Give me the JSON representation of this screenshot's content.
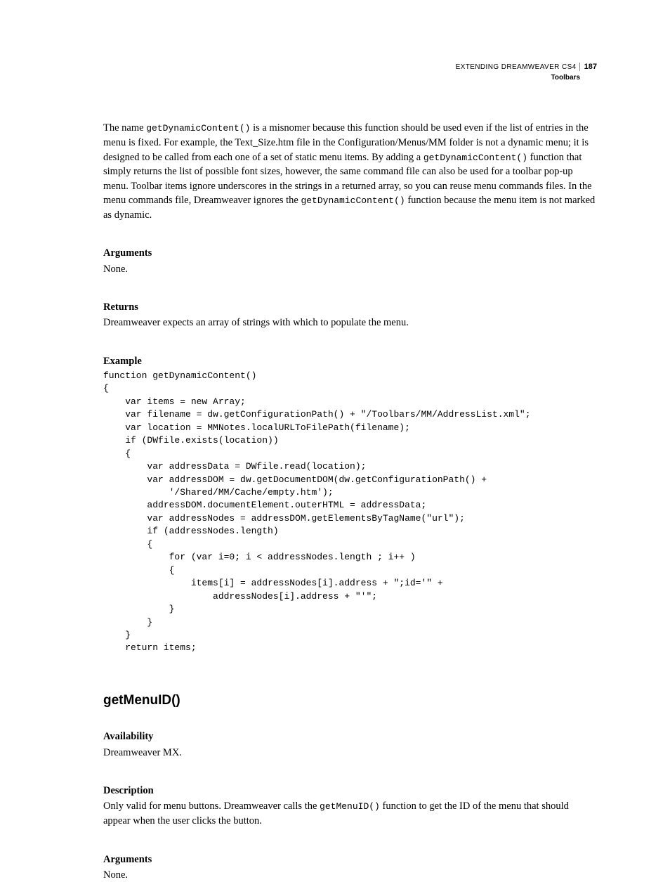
{
  "header": {
    "title": "EXTENDING DREAMWEAVER CS4",
    "page_number": "187",
    "section": "Toolbars"
  },
  "intro": {
    "text_parts": [
      "The name ",
      " is a misnomer because this function should be used even if the list of entries in the menu is fixed. For example, the Text_Size.htm file in the Configuration/Menus/MM folder is not a dynamic menu; it is designed to be called from each one of a set of static menu items. By adding a ",
      " function that simply returns the list of possible font sizes, however, the same command file can also be used for a toolbar pop-up menu. Toolbar items ignore underscores in the strings in a returned array, so you can reuse menu commands files. In the menu commands file, Dreamweaver ignores the ",
      " function because the menu item is not marked as dynamic."
    ],
    "code1": "getDynamicContent()",
    "code2": "getDynamicContent()",
    "code3": "getDynamicContent()"
  },
  "arguments1": {
    "heading": "Arguments",
    "body": "None."
  },
  "returns": {
    "heading": "Returns",
    "body": "Dreamweaver expects an array of strings with which to populate the menu."
  },
  "example": {
    "heading": "Example",
    "code": "function getDynamicContent()\n{\n    var items = new Array;\n    var filename = dw.getConfigurationPath() + \"/Toolbars/MM/AddressList.xml\";\n    var location = MMNotes.localURLToFilePath(filename);\n    if (DWfile.exists(location))\n    {\n        var addressData = DWfile.read(location);\n        var addressDOM = dw.getDocumentDOM(dw.getConfigurationPath() +\n            '/Shared/MM/Cache/empty.htm');\n        addressDOM.documentElement.outerHTML = addressData;\n        var addressNodes = addressDOM.getElementsByTagName(\"url\");\n        if (addressNodes.length)\n        {\n            for (var i=0; i < addressNodes.length ; i++ )\n            {\n                items[i] = addressNodes[i].address + \";id='\" +\n                    addressNodes[i].address + \"'\";\n            }\n        }\n    }\n    return items;"
  },
  "func2": {
    "title": "getMenuID()",
    "availability": {
      "heading": "Availability",
      "body": "Dreamweaver MX."
    },
    "description": {
      "heading": "Description",
      "pre": "Only valid for menu buttons. Dreamweaver calls the ",
      "code": "getMenuID()",
      "post": " function to get the ID of the menu that should appear when the user clicks the button."
    },
    "arguments": {
      "heading": "Arguments",
      "body": "None."
    }
  }
}
